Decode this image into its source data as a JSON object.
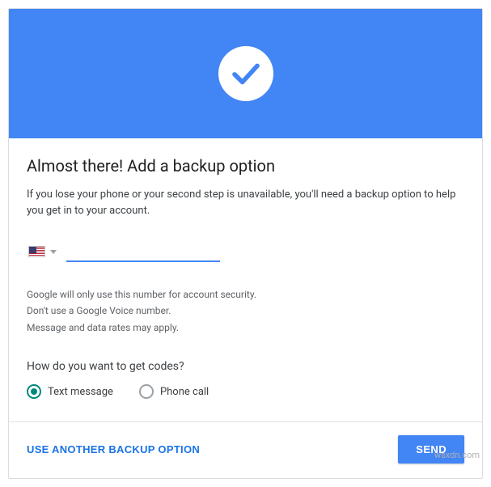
{
  "banner": {
    "icon": "checkmark-circle"
  },
  "title": "Almost there! Add a backup option",
  "description": "If you lose your phone or your second step is unavailable, you'll need a backup option to help you get in to your account.",
  "phone": {
    "country_code": "US",
    "value": "",
    "placeholder": ""
  },
  "hints": {
    "line1": "Google will only use this number for account security.",
    "line2": "Don't use a Google Voice number.",
    "line3": "Message and data rates may apply."
  },
  "codes": {
    "question": "How do you want to get codes?",
    "options": [
      {
        "id": "text",
        "label": "Text message",
        "selected": true
      },
      {
        "id": "call",
        "label": "Phone call",
        "selected": false
      }
    ]
  },
  "actions": {
    "alt_link": "USE ANOTHER BACKUP OPTION",
    "send": "SEND"
  },
  "watermark": "wsxdn.com"
}
